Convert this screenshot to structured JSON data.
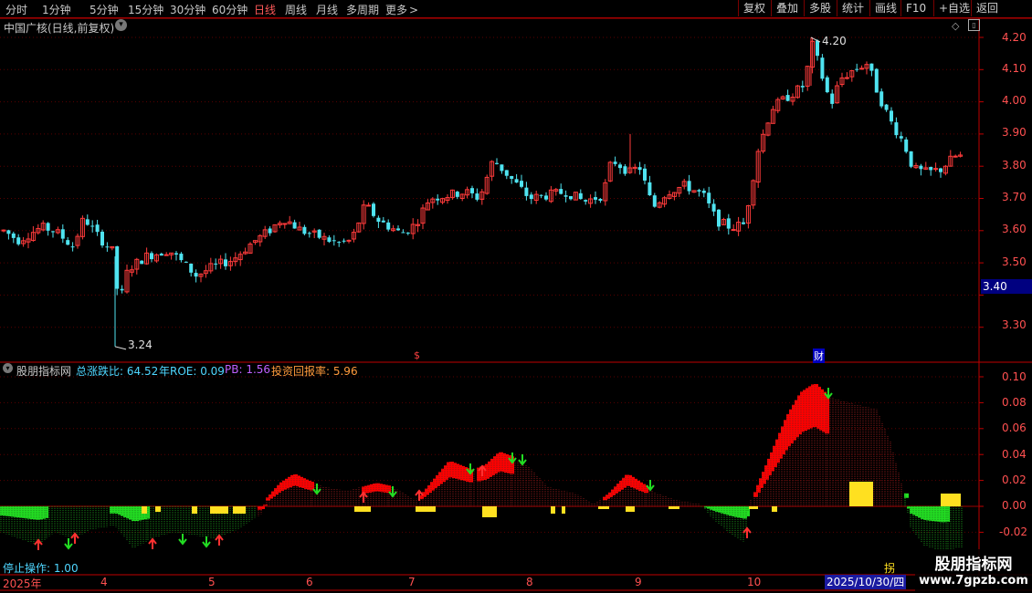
{
  "toolbar": {
    "periods": [
      "分时",
      "1分钟",
      "5分钟",
      "15分钟",
      "30分钟",
      "60分钟",
      "日线",
      "周线",
      "月线",
      "多周期",
      "更多"
    ],
    "active_period": "日线",
    "more_chevron": ">",
    "right": [
      "复权",
      "叠加",
      "多股",
      "统计",
      "画线",
      "F10",
      "+自选",
      "返回"
    ]
  },
  "main_chart": {
    "title": "中国广核(日线,前复权)",
    "high_label": "4.20",
    "low_label": "3.24",
    "price_axis": [
      "4.20",
      "4.10",
      "4.00",
      "3.90",
      "3.80",
      "3.70",
      "3.60",
      "3.50",
      "3.40",
      "3.30"
    ],
    "current_price": "3.40",
    "event_markers": [
      "$",
      "财"
    ],
    "colors": {
      "up": "#ff3b3b",
      "down": "#4fe3f0",
      "highlight_price_bg": "#000080"
    }
  },
  "indicator": {
    "name": "股朋指标网",
    "items": [
      {
        "label": "总涨跌比: 64.52",
        "color": "#4fd6ff"
      },
      {
        "label": "年ROE: 0.09",
        "color": "#4fd6ff"
      },
      {
        "label": "PB: 1.56",
        "color": "#c060ff"
      },
      {
        "label": "投资回报率: 5.96",
        "color": "#ff9a3c"
      }
    ],
    "axis": [
      "0.10",
      "0.08",
      "0.06",
      "0.04",
      "0.02",
      "0.00",
      "-0.02"
    ],
    "status_label": "停止操作: 1.00",
    "corner_label": "拐"
  },
  "time_axis": {
    "labels": [
      "2025年",
      "4",
      "5",
      "6",
      "7",
      "8",
      "9",
      "10"
    ],
    "cursor_date": "2025/10/30/四"
  },
  "watermark": {
    "title": "股朋指标网",
    "url": "www.7gpzb.com"
  }
}
